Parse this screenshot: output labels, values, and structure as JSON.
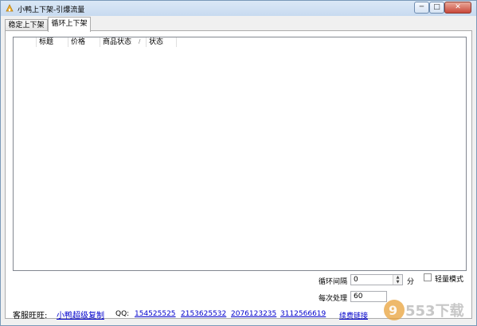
{
  "window": {
    "title": "小鸭上下架-引爆流量",
    "min_glyph": "─",
    "max_glyph": "□",
    "close_glyph": "✕"
  },
  "tabs": [
    {
      "label": "稳定上下架"
    },
    {
      "label": "循环上下架"
    }
  ],
  "table": {
    "columns": [
      "",
      "标题",
      "价格",
      "商品状态",
      "状态"
    ],
    "rows": []
  },
  "controls": {
    "interval_label": "循环间隔",
    "interval_value": "0",
    "interval_unit": "分",
    "batch_label": "每次处理",
    "batch_value": "60",
    "light_mode_label": "轻量模式"
  },
  "footer": {
    "service_label": "客服旺旺:",
    "service_link": "小鸭超级复制",
    "qq_label": "QQ:",
    "qq_numbers": [
      "154525525",
      "2153625532",
      "2076123235",
      "3112566619"
    ],
    "extra_link": "续费链接"
  },
  "watermark": {
    "text": "9553下载"
  },
  "colors": {
    "link": "#0000cc",
    "titlebar": "#c7daf0",
    "close_button": "#c9483a"
  }
}
